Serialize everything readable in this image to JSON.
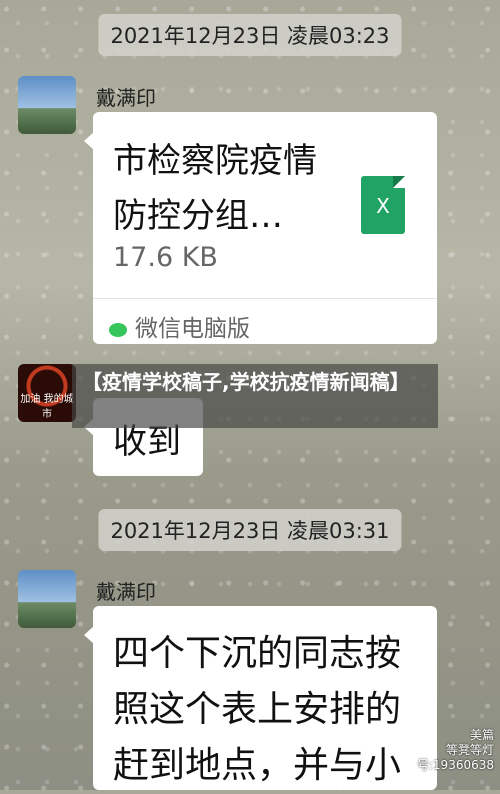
{
  "chat": {
    "timestamp1": "2021年12月23日 凌晨03:23",
    "sender1": "戴满印",
    "file": {
      "title": "市检察院疫情防控分组…",
      "size": "17.6 KB",
      "source": "微信电脑版",
      "icon": "excel-icon",
      "icon_label": "X"
    },
    "overlay_title": "【疫情学校稿子,学校抗疫情新闻稿】",
    "reply": "收到",
    "reply_avatar_label": "加油 我的城市",
    "timestamp2": "2021年12月23日 凌晨03:31",
    "sender2": "戴满印",
    "message": "四个下沉的同志按照这个表上安排的赶到地点，并与小"
  },
  "watermark": {
    "line1": "美篇",
    "line2": "等凳等灯",
    "line3": "号:19360638"
  }
}
